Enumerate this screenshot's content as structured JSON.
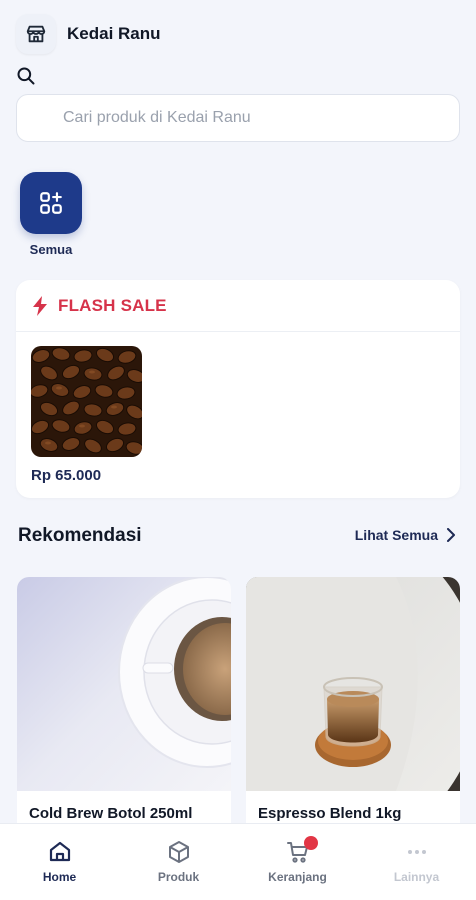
{
  "header": {
    "store_name": "Kedai Ranu",
    "search_placeholder": "Cari produk di Kedai Ranu"
  },
  "categories": [
    {
      "label": "Semua",
      "icon": "grid-plus-icon",
      "active": true
    }
  ],
  "flash_sale": {
    "title": "FLASH SALE",
    "icon": "lightning-icon",
    "items": [
      {
        "price": "Rp 65.000",
        "image": "coffee-beans"
      }
    ]
  },
  "recommendations": {
    "title": "Rekomendasi",
    "see_all": "Lihat Semua",
    "items": [
      {
        "name": "Cold Brew Botol 250ml",
        "image": "coffee-cup-top"
      },
      {
        "name": "Espresso Blend 1kg",
        "image": "espresso-glass"
      }
    ]
  },
  "bottom_nav": [
    {
      "label": "Home",
      "icon": "home-icon",
      "active": true
    },
    {
      "label": "Produk",
      "icon": "box-icon"
    },
    {
      "label": "Keranjang",
      "icon": "cart-icon",
      "badge": true
    },
    {
      "label": "Lainnya",
      "icon": "more-icon",
      "disabled": true
    }
  ],
  "colors": {
    "primary": "#1e3a8a",
    "flash": "#d6334a",
    "badge": "#e23645",
    "background": "#f3f5fb"
  }
}
